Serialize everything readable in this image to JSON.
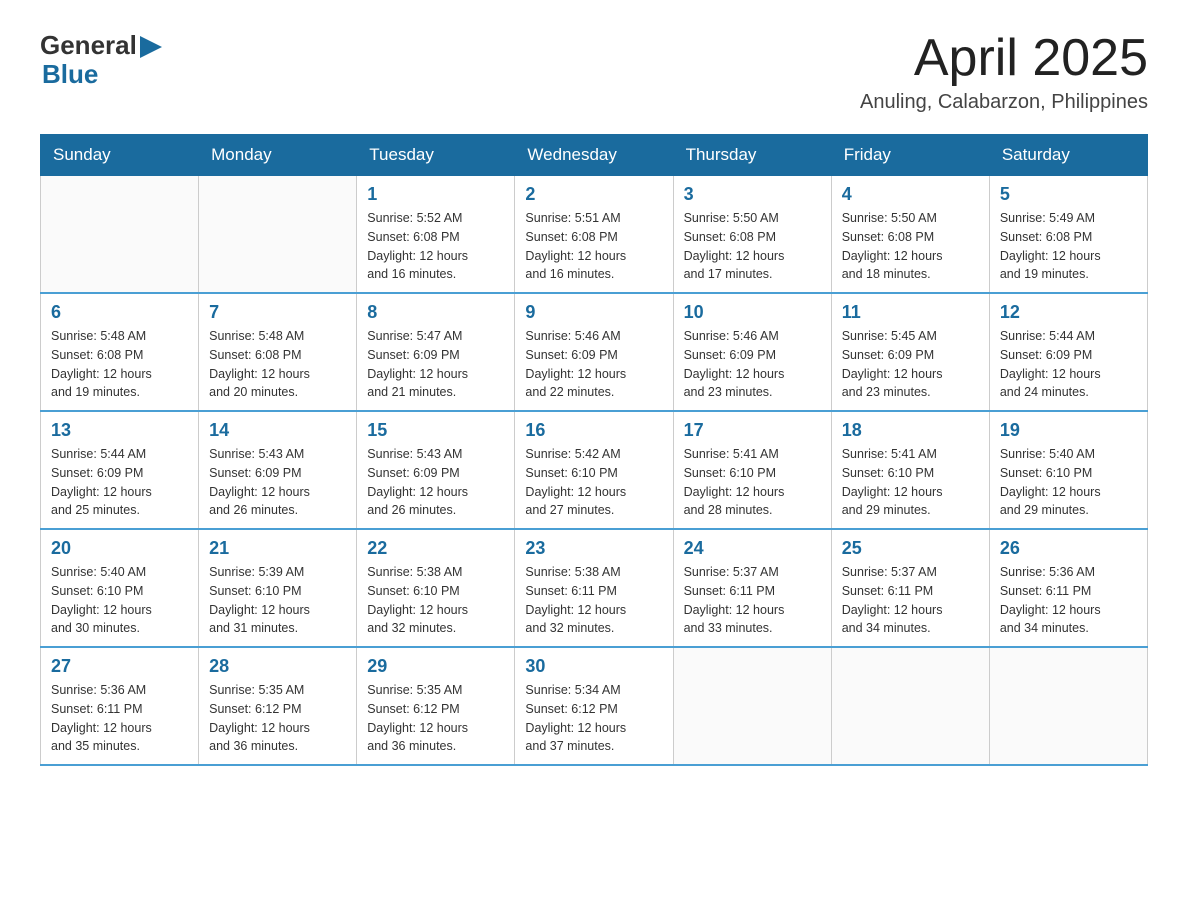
{
  "header": {
    "month_title": "April 2025",
    "location": "Anuling, Calabarzon, Philippines",
    "logo_general": "General",
    "logo_blue": "Blue"
  },
  "calendar": {
    "days_of_week": [
      "Sunday",
      "Monday",
      "Tuesday",
      "Wednesday",
      "Thursday",
      "Friday",
      "Saturday"
    ],
    "weeks": [
      [
        {
          "day": "",
          "info": ""
        },
        {
          "day": "",
          "info": ""
        },
        {
          "day": "1",
          "info": "Sunrise: 5:52 AM\nSunset: 6:08 PM\nDaylight: 12 hours\nand 16 minutes."
        },
        {
          "day": "2",
          "info": "Sunrise: 5:51 AM\nSunset: 6:08 PM\nDaylight: 12 hours\nand 16 minutes."
        },
        {
          "day": "3",
          "info": "Sunrise: 5:50 AM\nSunset: 6:08 PM\nDaylight: 12 hours\nand 17 minutes."
        },
        {
          "day": "4",
          "info": "Sunrise: 5:50 AM\nSunset: 6:08 PM\nDaylight: 12 hours\nand 18 minutes."
        },
        {
          "day": "5",
          "info": "Sunrise: 5:49 AM\nSunset: 6:08 PM\nDaylight: 12 hours\nand 19 minutes."
        }
      ],
      [
        {
          "day": "6",
          "info": "Sunrise: 5:48 AM\nSunset: 6:08 PM\nDaylight: 12 hours\nand 19 minutes."
        },
        {
          "day": "7",
          "info": "Sunrise: 5:48 AM\nSunset: 6:08 PM\nDaylight: 12 hours\nand 20 minutes."
        },
        {
          "day": "8",
          "info": "Sunrise: 5:47 AM\nSunset: 6:09 PM\nDaylight: 12 hours\nand 21 minutes."
        },
        {
          "day": "9",
          "info": "Sunrise: 5:46 AM\nSunset: 6:09 PM\nDaylight: 12 hours\nand 22 minutes."
        },
        {
          "day": "10",
          "info": "Sunrise: 5:46 AM\nSunset: 6:09 PM\nDaylight: 12 hours\nand 23 minutes."
        },
        {
          "day": "11",
          "info": "Sunrise: 5:45 AM\nSunset: 6:09 PM\nDaylight: 12 hours\nand 23 minutes."
        },
        {
          "day": "12",
          "info": "Sunrise: 5:44 AM\nSunset: 6:09 PM\nDaylight: 12 hours\nand 24 minutes."
        }
      ],
      [
        {
          "day": "13",
          "info": "Sunrise: 5:44 AM\nSunset: 6:09 PM\nDaylight: 12 hours\nand 25 minutes."
        },
        {
          "day": "14",
          "info": "Sunrise: 5:43 AM\nSunset: 6:09 PM\nDaylight: 12 hours\nand 26 minutes."
        },
        {
          "day": "15",
          "info": "Sunrise: 5:43 AM\nSunset: 6:09 PM\nDaylight: 12 hours\nand 26 minutes."
        },
        {
          "day": "16",
          "info": "Sunrise: 5:42 AM\nSunset: 6:10 PM\nDaylight: 12 hours\nand 27 minutes."
        },
        {
          "day": "17",
          "info": "Sunrise: 5:41 AM\nSunset: 6:10 PM\nDaylight: 12 hours\nand 28 minutes."
        },
        {
          "day": "18",
          "info": "Sunrise: 5:41 AM\nSunset: 6:10 PM\nDaylight: 12 hours\nand 29 minutes."
        },
        {
          "day": "19",
          "info": "Sunrise: 5:40 AM\nSunset: 6:10 PM\nDaylight: 12 hours\nand 29 minutes."
        }
      ],
      [
        {
          "day": "20",
          "info": "Sunrise: 5:40 AM\nSunset: 6:10 PM\nDaylight: 12 hours\nand 30 minutes."
        },
        {
          "day": "21",
          "info": "Sunrise: 5:39 AM\nSunset: 6:10 PM\nDaylight: 12 hours\nand 31 minutes."
        },
        {
          "day": "22",
          "info": "Sunrise: 5:38 AM\nSunset: 6:10 PM\nDaylight: 12 hours\nand 32 minutes."
        },
        {
          "day": "23",
          "info": "Sunrise: 5:38 AM\nSunset: 6:11 PM\nDaylight: 12 hours\nand 32 minutes."
        },
        {
          "day": "24",
          "info": "Sunrise: 5:37 AM\nSunset: 6:11 PM\nDaylight: 12 hours\nand 33 minutes."
        },
        {
          "day": "25",
          "info": "Sunrise: 5:37 AM\nSunset: 6:11 PM\nDaylight: 12 hours\nand 34 minutes."
        },
        {
          "day": "26",
          "info": "Sunrise: 5:36 AM\nSunset: 6:11 PM\nDaylight: 12 hours\nand 34 minutes."
        }
      ],
      [
        {
          "day": "27",
          "info": "Sunrise: 5:36 AM\nSunset: 6:11 PM\nDaylight: 12 hours\nand 35 minutes."
        },
        {
          "day": "28",
          "info": "Sunrise: 5:35 AM\nSunset: 6:12 PM\nDaylight: 12 hours\nand 36 minutes."
        },
        {
          "day": "29",
          "info": "Sunrise: 5:35 AM\nSunset: 6:12 PM\nDaylight: 12 hours\nand 36 minutes."
        },
        {
          "day": "30",
          "info": "Sunrise: 5:34 AM\nSunset: 6:12 PM\nDaylight: 12 hours\nand 37 minutes."
        },
        {
          "day": "",
          "info": ""
        },
        {
          "day": "",
          "info": ""
        },
        {
          "day": "",
          "info": ""
        }
      ]
    ]
  }
}
